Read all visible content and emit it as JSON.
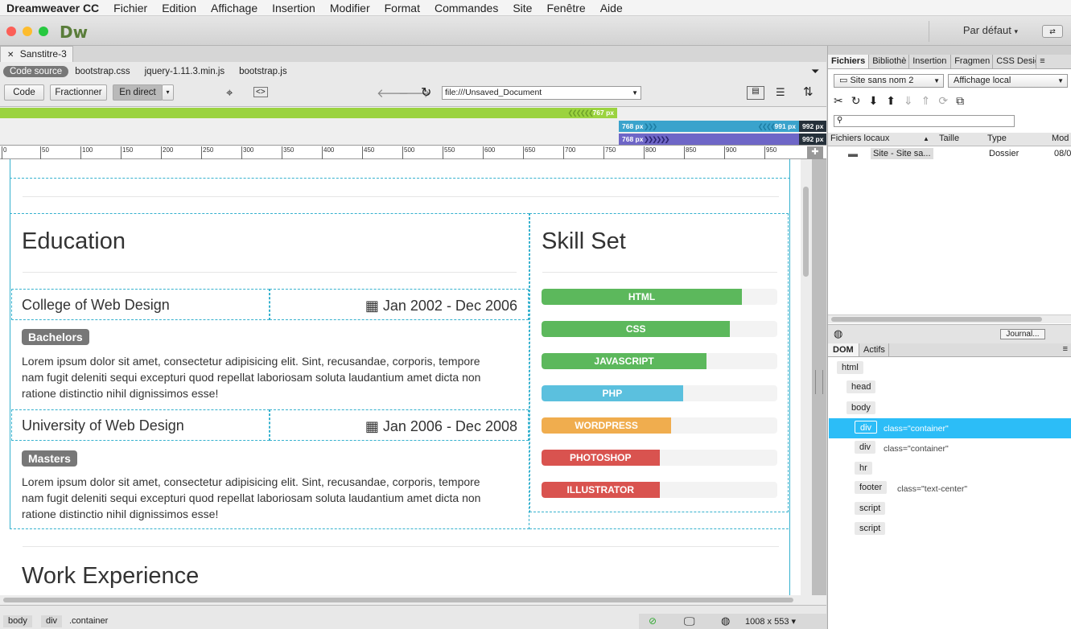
{
  "menubar": {
    "app": "Dreamweaver CC",
    "items": [
      "Fichier",
      "Edition",
      "Affichage",
      "Insertion",
      "Modifier",
      "Format",
      "Commandes",
      "Site",
      "Fenêtre",
      "Aide"
    ]
  },
  "titlebar": {
    "logo": "Dw",
    "workspace": "Par défaut"
  },
  "document": {
    "tab": "Sanstitre-3",
    "related": [
      "Code source",
      "bootstrap.css",
      "jquery-1.11.3.min.js",
      "bootstrap.js"
    ],
    "views": {
      "code": "Code",
      "split": "Fractionner",
      "live": "En direct"
    },
    "url": "file:///Unsaved_Document"
  },
  "media_queries": {
    "bar1_label": "767  px",
    "bar2_start": "768  px",
    "bar2_end": "991  px",
    "bar3_start": "768  px",
    "dark1": "992  px",
    "dark2": "992  px"
  },
  "ruler": [
    "0",
    "50",
    "100",
    "150",
    "200",
    "250",
    "300",
    "350",
    "400",
    "450",
    "500",
    "550",
    "600",
    "650",
    "700",
    "750",
    "800",
    "850",
    "900",
    "950"
  ],
  "page": {
    "education": {
      "heading": "Education",
      "items": [
        {
          "school": "College of Web Design",
          "dates": "Jan 2002 - Dec 2006",
          "degree": "Bachelors",
          "text": "Lorem ipsum dolor sit amet, consectetur adipisicing elit. Sint, recusandae, corporis, tempore nam fugit deleniti sequi excepturi quod repellat laboriosam soluta laudantium amet dicta non ratione distinctio nihil dignissimos esse!"
        },
        {
          "school": "University of Web Design",
          "dates": "Jan 2006 - Dec 2008",
          "degree": "Masters",
          "text": "Lorem ipsum dolor sit amet, consectetur adipisicing elit. Sint, recusandae, corporis, tempore nam fugit deleniti sequi excepturi quod repellat laboriosam soluta laudantium amet dicta non ratione distinctio nihil dignissimos esse!"
        }
      ]
    },
    "skills": {
      "heading": "Skill Set",
      "items": [
        {
          "name": "HTML",
          "level": 0.85,
          "color": "#5cb85c"
        },
        {
          "name": "CSS",
          "level": 0.8,
          "color": "#5cb85c"
        },
        {
          "name": "JAVASCRIPT",
          "level": 0.7,
          "color": "#5cb85c"
        },
        {
          "name": "PHP",
          "level": 0.6,
          "color": "#5bc0de"
        },
        {
          "name": "WORDPRESS",
          "level": 0.55,
          "color": "#f0ad4e"
        },
        {
          "name": "PHOTOSHOP",
          "level": 0.5,
          "color": "#d9534f"
        },
        {
          "name": "ILLUSTRATOR",
          "level": 0.5,
          "color": "#d9534f"
        }
      ]
    },
    "work_heading": "Work Experience"
  },
  "status": {
    "crumbs": [
      "body",
      "div",
      ".container"
    ],
    "size": "1008 x 553"
  },
  "files_panel": {
    "tabs": [
      "Fichiers",
      "Bibliothè",
      "Insertion",
      "Fragmen",
      "CSS Desig"
    ],
    "site": "Site sans nom 2",
    "view": "Affichage local",
    "columns": [
      "Fichiers locaux",
      "Taille",
      "Type",
      "Mod"
    ],
    "row": {
      "name": "Site - Site sa...",
      "type": "Dossier",
      "date": "08/0"
    },
    "journal": "Journal..."
  },
  "dom_panel": {
    "tabs": [
      "DOM",
      "Actifs"
    ],
    "nodes": [
      {
        "tag": "html",
        "attr": ""
      },
      {
        "tag": "head",
        "attr": ""
      },
      {
        "tag": "body",
        "attr": ""
      },
      {
        "tag": "div",
        "attr": "class=\"container\""
      },
      {
        "tag": "div",
        "attr": "class=\"container\""
      },
      {
        "tag": "hr",
        "attr": ""
      },
      {
        "tag": "footer",
        "attr": "class=\"text-center\""
      },
      {
        "tag": "script",
        "attr": ""
      },
      {
        "tag": "script",
        "attr": ""
      }
    ]
  }
}
